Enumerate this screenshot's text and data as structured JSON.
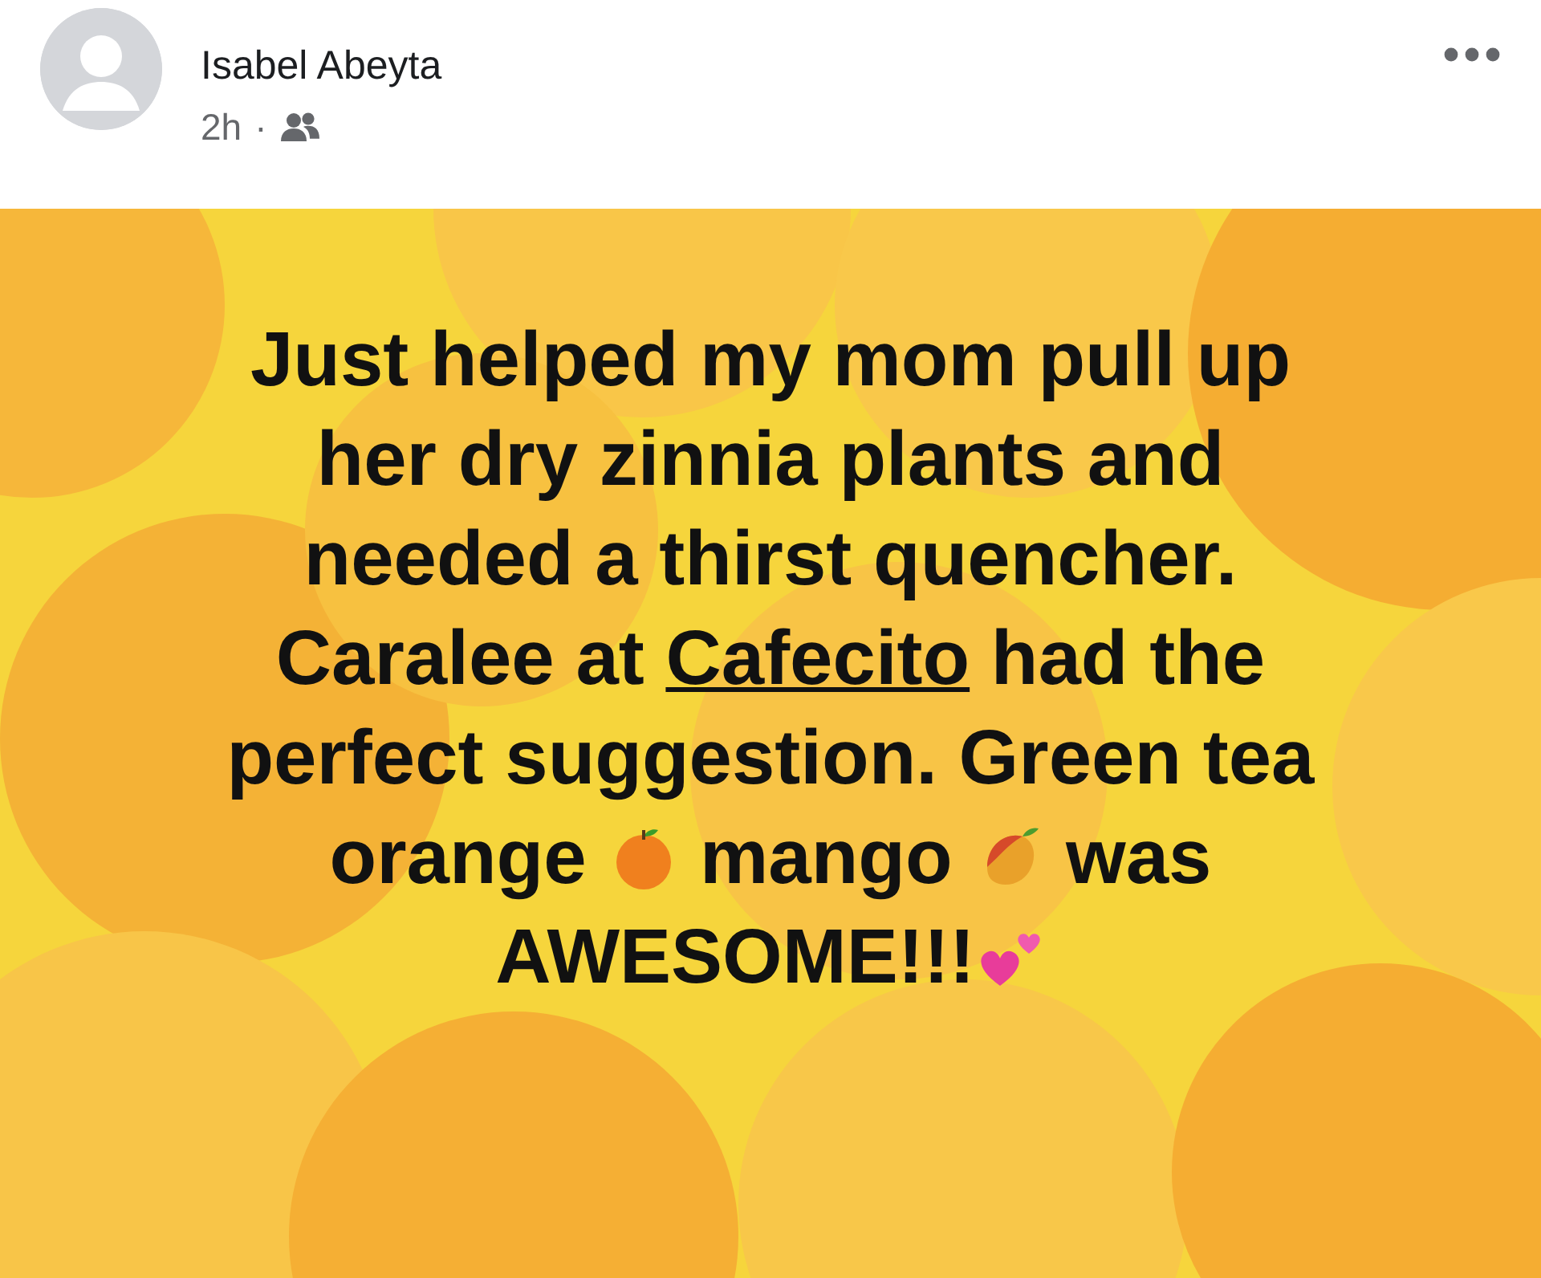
{
  "post": {
    "author": "Isabel Abeyta",
    "time": "2h",
    "separator": "·",
    "body": [
      {
        "kind": "text",
        "text": "Just helped my mom pull up her dry zinnia plants and needed a thirst quencher. Caralee at "
      },
      {
        "kind": "link",
        "text": "Cafecito"
      },
      {
        "kind": "text",
        "text": " had the perfect suggestion. Green tea orange "
      },
      {
        "kind": "orange"
      },
      {
        "kind": "text",
        "text": " mango "
      },
      {
        "kind": "mango"
      },
      {
        "kind": "text",
        "text": " was AWESOME!!!"
      },
      {
        "kind": "hearts"
      }
    ]
  }
}
